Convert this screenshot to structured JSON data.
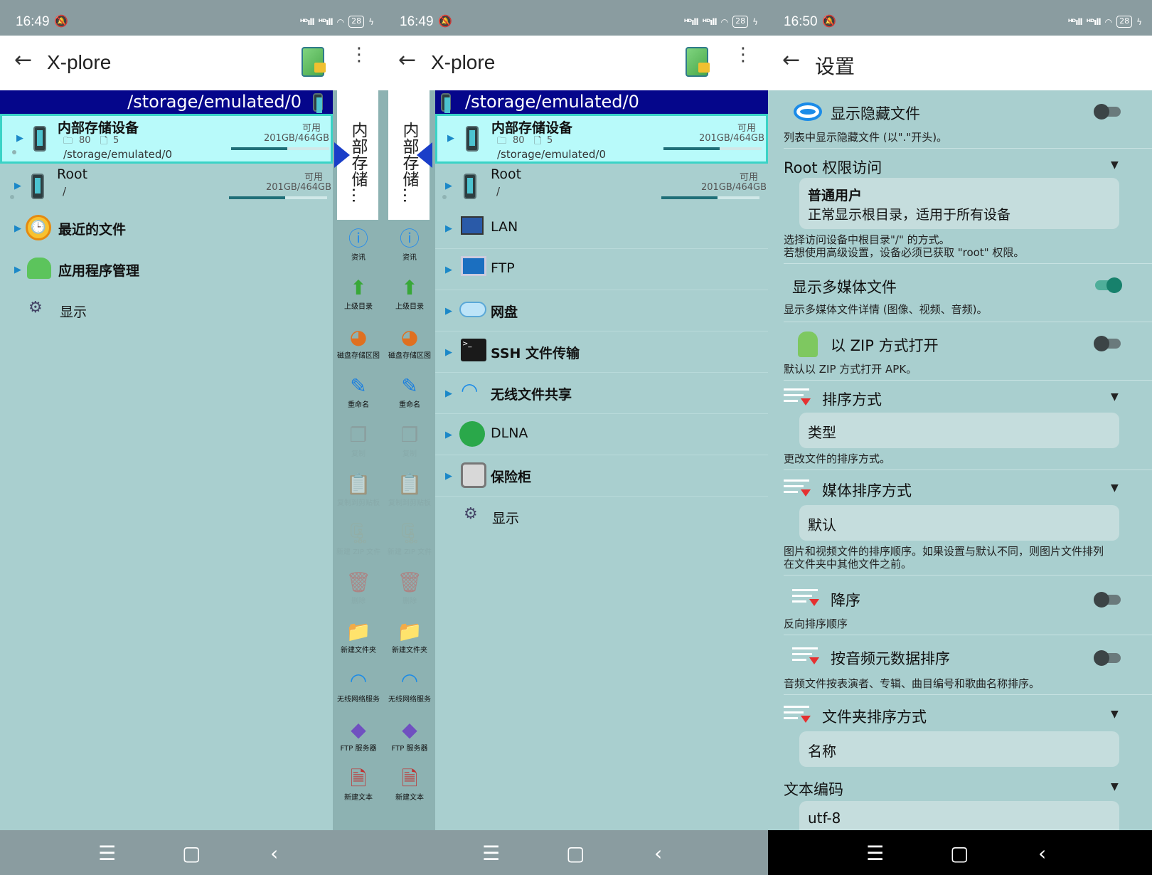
{
  "status": [
    {
      "time": "16:49",
      "battery": "28"
    },
    {
      "time": "16:49",
      "battery": "28"
    },
    {
      "time": "16:50",
      "battery": "28"
    }
  ],
  "app_title": "X-plore",
  "settings_title": "设置",
  "left_pane": {
    "path": "/storage/emulated/0",
    "storage": {
      "name": "内部存储设备",
      "available_label": "可用",
      "folders": "80",
      "files": "5",
      "size": "201GB/464GB",
      "path": "/storage/emulated/0",
      "used_fraction": 0.57
    },
    "root": {
      "name": "Root",
      "available_label": "可用",
      "path": "/",
      "size": "201GB/464GB",
      "used_fraction": 0.57
    },
    "items": [
      "最近的文件",
      "应用程序管理",
      "显示"
    ]
  },
  "strip": {
    "label_left": "内部存储…",
    "label_right": "内部存储…",
    "tools": [
      {
        "icon": "info-icon",
        "label": "资讯",
        "enabled": true
      },
      {
        "icon": "up-arrow-icon",
        "label": "上级目录",
        "enabled": true
      },
      {
        "icon": "disk-map-icon",
        "label": "磁盘存储区图",
        "enabled": true
      },
      {
        "icon": "rename-icon",
        "label": "重命名",
        "enabled": true
      },
      {
        "icon": "copy-icon",
        "label": "复制",
        "enabled": false
      },
      {
        "icon": "clipboard-icon",
        "label": "复制到剪贴板",
        "enabled": false
      },
      {
        "icon": "zip-icon",
        "label": "新建 ZIP 文件",
        "enabled": false
      },
      {
        "icon": "trash-icon",
        "label": "删除",
        "enabled": false
      },
      {
        "icon": "new-folder-icon",
        "label": "新建文件夹",
        "enabled": true
      },
      {
        "icon": "wifi-icon",
        "label": "无线网络服务",
        "enabled": true
      },
      {
        "icon": "ftp-server-icon",
        "label": "FTP 服务器",
        "enabled": true
      },
      {
        "icon": "new-text-icon",
        "label": "新建文本",
        "enabled": true
      }
    ]
  },
  "right_pane": {
    "path": "/storage/emulated/0",
    "storage": {
      "name": "内部存储设备",
      "available_label": "可用",
      "folders": "80",
      "files": "5",
      "size": "201GB/464GB",
      "path": "/storage/emulated/0",
      "used_fraction": 0.57
    },
    "root": {
      "name": "Root",
      "available_label": "可用",
      "path": "/",
      "size": "201GB/464GB",
      "used_fraction": 0.57
    },
    "items": [
      "LAN",
      "FTP",
      "网盘",
      "SSH 文件传输",
      "无线文件共享",
      "DLNA",
      "保险柜",
      "显示"
    ]
  },
  "settings": {
    "show_hidden": {
      "title": "显示隐藏文件",
      "desc": "列表中显示隐藏文件 (以\".\"开头)。",
      "on": false
    },
    "root_access": {
      "title": "Root 权限访问",
      "value_title": "普通用户",
      "value_desc": "正常显示根目录，适用于所有设备",
      "desc1": "选择访问设备中根目录\"/\" 的方式。",
      "desc2": "若想使用高级设置，设备必须已获取 \"root\" 权限。"
    },
    "show_media": {
      "title": "显示多媒体文件",
      "desc": "显示多媒体文件详情 (图像、视频、音频)。",
      "on": true
    },
    "zip_open": {
      "title": "以 ZIP 方式打开",
      "desc": "默认以 ZIP 方式打开 APK。",
      "on": false
    },
    "sort_mode": {
      "title": "排序方式",
      "value": "类型",
      "desc": "更改文件的排序方式。"
    },
    "media_sort": {
      "title": "媒体排序方式",
      "value": "默认",
      "desc1": "图片和视频文件的排序顺序。如果设置与默认不同，则图片文件排列",
      "desc2": "在文件夹中其他文件之前。"
    },
    "descending": {
      "title": "降序",
      "desc": "反向排序顺序",
      "on": false
    },
    "audio_meta": {
      "title": "按音频元数据排序",
      "desc": "音频文件按表演者、专辑、曲目编号和歌曲名称排序。",
      "on": false
    },
    "folder_sort": {
      "title": "文件夹排序方式",
      "value": "名称"
    },
    "encoding": {
      "title": "文本编码",
      "value": "utf-8"
    }
  },
  "nav": {
    "menu": "☰",
    "home": "▢",
    "back": "‹"
  },
  "colors": {
    "path_bar": "#05068b",
    "selected_row": "#b8fafa",
    "background": "#a9cfcf",
    "toggle_on": "#17816c"
  }
}
